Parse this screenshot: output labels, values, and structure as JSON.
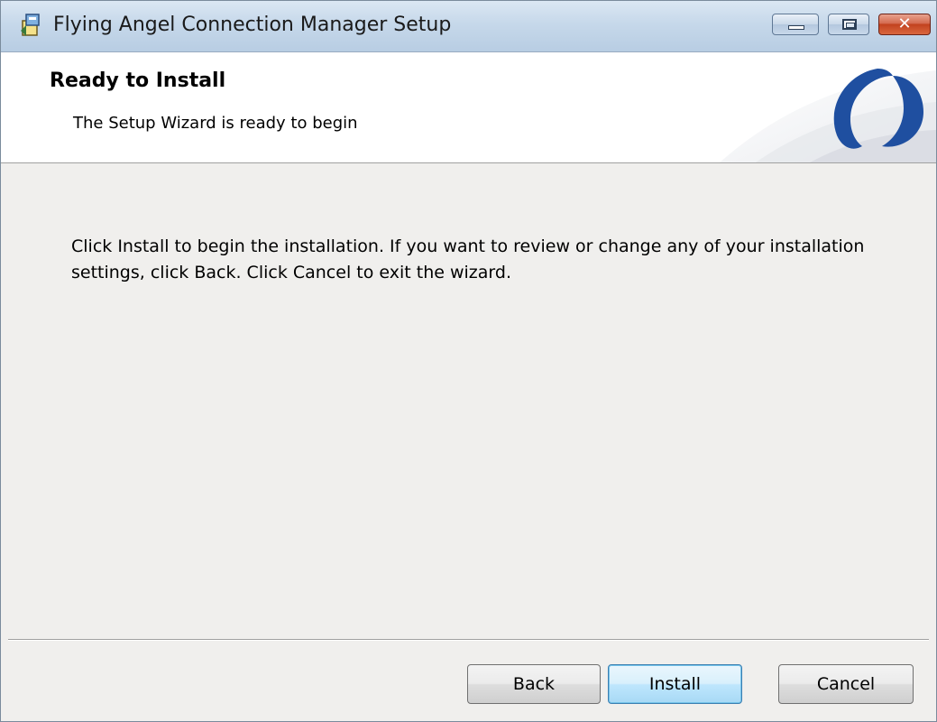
{
  "window": {
    "title": "Flying Angel Connection Manager Setup",
    "icon": "installer-package-icon"
  },
  "title_buttons": {
    "minimize_icon": "minimize-icon",
    "maximize_icon": "maximize-icon",
    "close_label": "✕"
  },
  "banner": {
    "title": "Ready to Install",
    "subtitle": "The Setup Wizard is ready to begin",
    "logo_icon": "crescent-logo-icon",
    "logo_color": "#1f4fa0"
  },
  "body": {
    "message": "Click Install to begin the installation. If you want to review or change any of your installation settings, click Back. Click Cancel to exit the wizard."
  },
  "buttons": {
    "back": "Back",
    "install": "Install",
    "cancel": "Cancel"
  }
}
